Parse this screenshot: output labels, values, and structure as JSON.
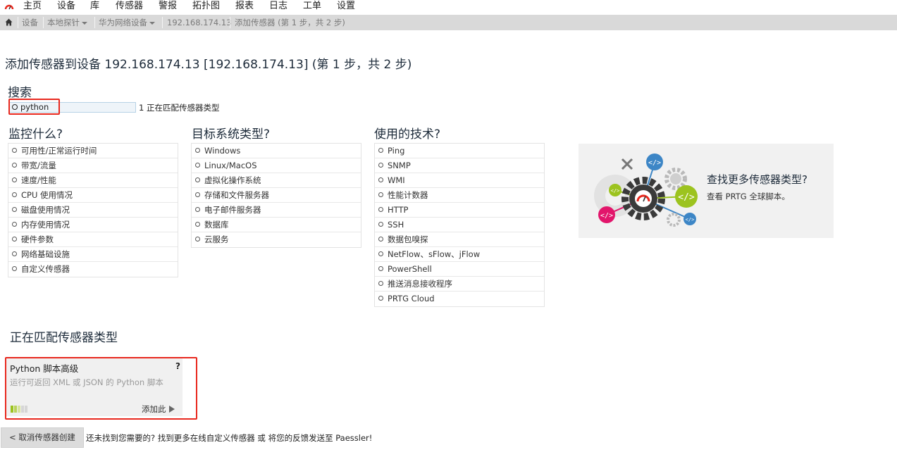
{
  "menu": [
    "主页",
    "设备",
    "库",
    "传感器",
    "警报",
    "拓扑图",
    "报表",
    "日志",
    "工单",
    "设置"
  ],
  "breadcrumb": {
    "items": [
      "设备",
      "本地探针",
      "华为网络设备",
      "192.168.174.13",
      "添加传感器 (第 1 步，共 2 步)"
    ]
  },
  "page_title": "添加传感器到设备 192.168.174.13 [192.168.174.13] (第 1 步，共 2 步)",
  "search": {
    "heading": "搜索",
    "value": "python",
    "count_text": "1 正在匹配传感器类型"
  },
  "filters": {
    "monitor": {
      "heading": "监控什么?",
      "items": [
        "可用性/正常运行时间",
        "带宽/流量",
        "速度/性能",
        "CPU 使用情况",
        "磁盘使用情况",
        "内存使用情况",
        "硬件参数",
        "网络基础设施",
        "自定义传感器"
      ]
    },
    "target": {
      "heading": "目标系统类型?",
      "items": [
        "Windows",
        "Linux/MacOS",
        "虚拟化操作系统",
        "存储和文件服务器",
        "电子邮件服务器",
        "数据库",
        "云服务"
      ]
    },
    "tech": {
      "heading": "使用的技术?",
      "items": [
        "Ping",
        "SNMP",
        "WMI",
        "性能计数器",
        "HTTP",
        "SSH",
        "数据包嗅探",
        "NetFlow、sFlow、jFlow",
        "PowerShell",
        "推送消息接收程序",
        "PRTG Cloud"
      ]
    }
  },
  "promo": {
    "title": "查找更多传感器类型?",
    "subtitle": "查看 PRTG 全球脚本。"
  },
  "matching": {
    "heading": "正在匹配传感器类型",
    "card": {
      "name": "Python 脚本高级",
      "help": "?",
      "description": "运行可返回 XML 或 JSON 的 Python 脚本",
      "add_label": "添加此"
    }
  },
  "footer": {
    "cancel_label": "< 取消传感器创建",
    "text_1": "还未找到您需要的? ",
    "link_1": "找到更多在线自定义传感器",
    "text_2": " 或 ",
    "link_2": "将您的反馈发送至 Paessler!"
  },
  "colors": {
    "accent_red": "#e8281e",
    "crumb_bg": "#d9d9d9",
    "promo_blue": "#3d86c6",
    "promo_green": "#9cc31f",
    "promo_pink": "#e2156b"
  }
}
